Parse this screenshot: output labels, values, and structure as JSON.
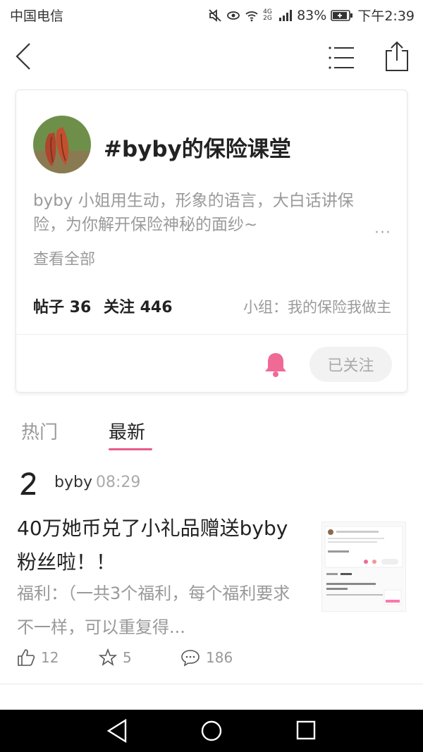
{
  "status_bar": {
    "carrier": "中国电信",
    "network": "4G 2G",
    "battery": "83%",
    "time": "下午2:39"
  },
  "header": {
    "back_icon": "chevron-left-icon",
    "menu_icon": "list-icon",
    "share_icon": "share-icon"
  },
  "topic": {
    "title": "#byby的保险课堂",
    "description": "byby 小姐用生动，形象的语言，大白话讲保险，为你解开保险神秘的面纱~",
    "more": "···",
    "see_all": "查看全部",
    "posts_label": "帖子 36",
    "followers_label": "关注 446",
    "group": "小组：我的保险我做主",
    "follow_button": "已关注",
    "accent_color": "#f06a96"
  },
  "tabs": [
    {
      "label": "热门",
      "active": false
    },
    {
      "label": "最新",
      "active": true
    }
  ],
  "post": {
    "user": "byby",
    "time": "08:29",
    "title": "40万她币兑了小礼品赠送byby粉丝啦！！",
    "excerpt": "福利：（一共3个福利，每个福利要求不一样，可以重复得...",
    "likes": "12",
    "favorites": "5",
    "comments": "186"
  }
}
